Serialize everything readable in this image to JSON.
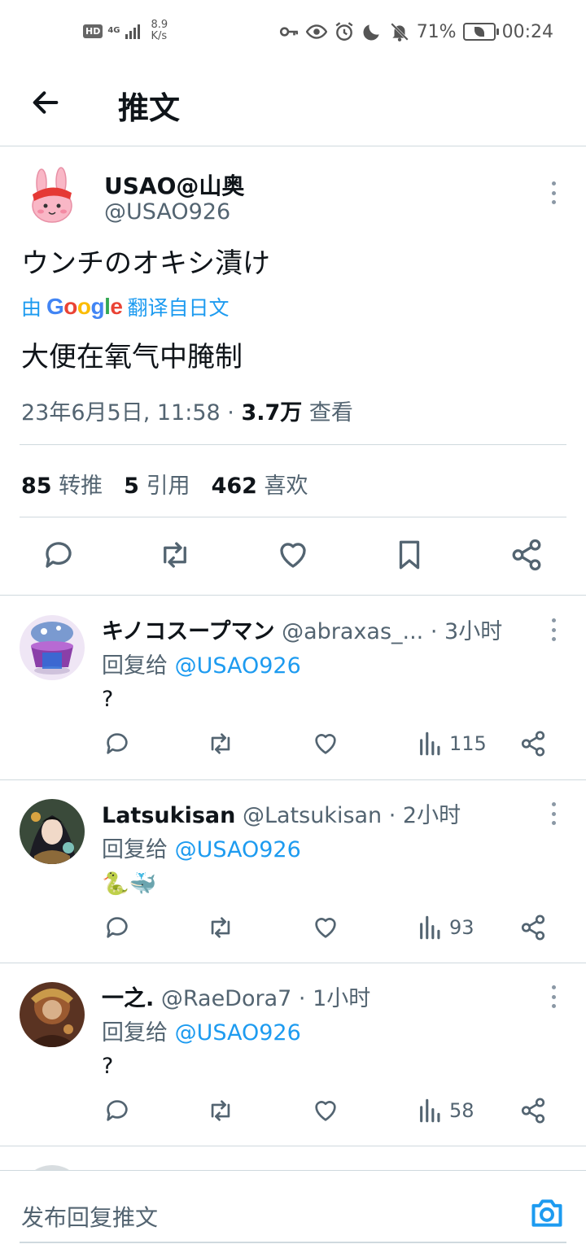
{
  "status_bar": {
    "hd": "HD",
    "network": "4G",
    "speed_value": "8.9",
    "speed_unit": "K/s",
    "battery": "71%",
    "time": "00:24"
  },
  "header": {
    "title": "推文"
  },
  "main_tweet": {
    "author_name": "USAO@山奥",
    "author_handle": "@USAO926",
    "text": "ウンチのオキシ漬け",
    "translate_prefix": "由",
    "translate_brand": "Google",
    "translate_suffix": "翻译自日文",
    "translated_text": "大便在氧气中腌制",
    "timestamp": "23年6月5日, 11:58 · ",
    "views_count": "3.7万",
    "views_label": " 查看",
    "retweets_count": "85",
    "retweets_label": "转推",
    "quotes_count": "5",
    "quotes_label": "引用",
    "likes_count": "462",
    "likes_label": "喜欢"
  },
  "replies": [
    {
      "name": "キノコスープマン",
      "handle": "@abraxas_...",
      "time": "· 3小时",
      "reply_prefix": "回复给",
      "reply_to": "@USAO926",
      "text": "?",
      "views": "115"
    },
    {
      "name": "Latsukisan",
      "handle": "@Latsukisan",
      "time": "· 2小时",
      "reply_prefix": "回复给",
      "reply_to": "@USAO926",
      "text": "🐍🐳",
      "views": "93"
    },
    {
      "name": "一之.",
      "handle": "@RaeDora7",
      "time": "· 1小时",
      "reply_prefix": "回复给",
      "reply_to": "@USAO926",
      "text": "?",
      "views": "58"
    }
  ],
  "compose": {
    "placeholder": "发布回复推文"
  },
  "colors": {
    "accent": "#1d9bf0",
    "secondary_text": "#536471",
    "divider": "#cfd9de"
  }
}
